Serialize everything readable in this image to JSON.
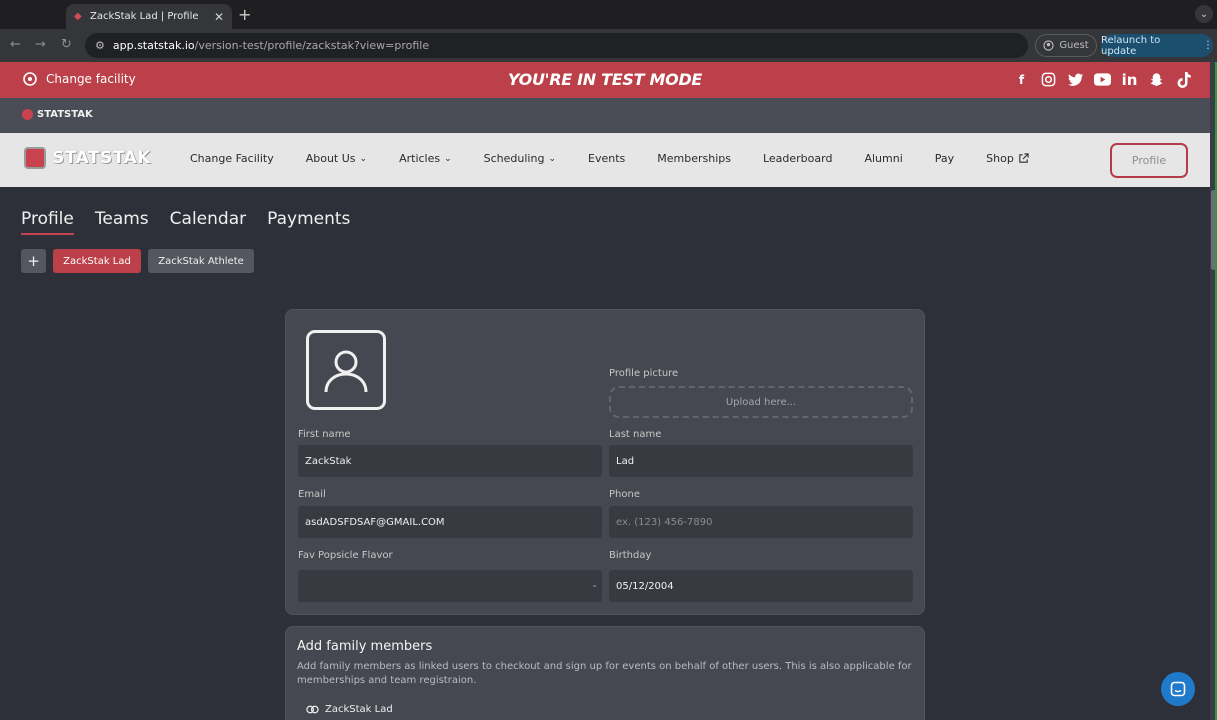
{
  "browser": {
    "tab_title": "ZackStak Lad | Profile",
    "url_host": "app.statstak.io",
    "url_path": "/version-test/profile/zackstak?view=profile",
    "guest_label": "Guest",
    "relaunch_label": "Relaunch to update"
  },
  "banner": {
    "change_facility": "Change facility",
    "test_mode": "YOU'RE IN TEST MODE",
    "social_icons": [
      "facebook-icon",
      "instagram-icon",
      "twitter-icon",
      "youtube-icon",
      "linkedin-icon",
      "snapchat-icon",
      "tiktok-icon"
    ],
    "color": "#bb4049"
  },
  "brandbar": {
    "logo_text": "STATSTAK"
  },
  "nav": {
    "logo_text": "STATSTAK",
    "items": [
      {
        "label": "Change Facility",
        "dropdown": false
      },
      {
        "label": "About Us",
        "dropdown": true
      },
      {
        "label": "Articles",
        "dropdown": true
      },
      {
        "label": "Scheduling",
        "dropdown": true
      },
      {
        "label": "Events",
        "dropdown": false
      },
      {
        "label": "Memberships",
        "dropdown": false
      },
      {
        "label": "Leaderboard",
        "dropdown": false
      },
      {
        "label": "Alumni",
        "dropdown": false
      },
      {
        "label": "Pay",
        "dropdown": false
      },
      {
        "label": "Shop",
        "dropdown": false,
        "external": true
      }
    ],
    "profile_button": "Profile"
  },
  "page_tabs": [
    "Profile",
    "Teams",
    "Calendar",
    "Payments"
  ],
  "profiles": {
    "add_label": "+",
    "items": [
      "ZackStak Lad",
      "ZackStak Athlete"
    ]
  },
  "form": {
    "profile_picture_label": "Profile picture",
    "upload_placeholder": "Upload here...",
    "first_name_label": "First name",
    "first_name_value": "ZackStak",
    "last_name_label": "Last name",
    "last_name_value": "Lad",
    "email_label": "Email",
    "email_value": "asdADSFDSAF@GMAIL.COM",
    "phone_label": "Phone",
    "phone_placeholder": "ex. (123) 456-7890",
    "popsicle_label": "Fav Popsicle Flavor",
    "popsicle_value": "",
    "birthday_label": "Birthday",
    "birthday_value": "05/12/2004"
  },
  "family": {
    "title": "Add family members",
    "description": "Add family members as linked users to checkout and sign up for events on behalf of other users. This is also applicable for memberships and team registraion.",
    "member": "ZackStak Lad"
  }
}
